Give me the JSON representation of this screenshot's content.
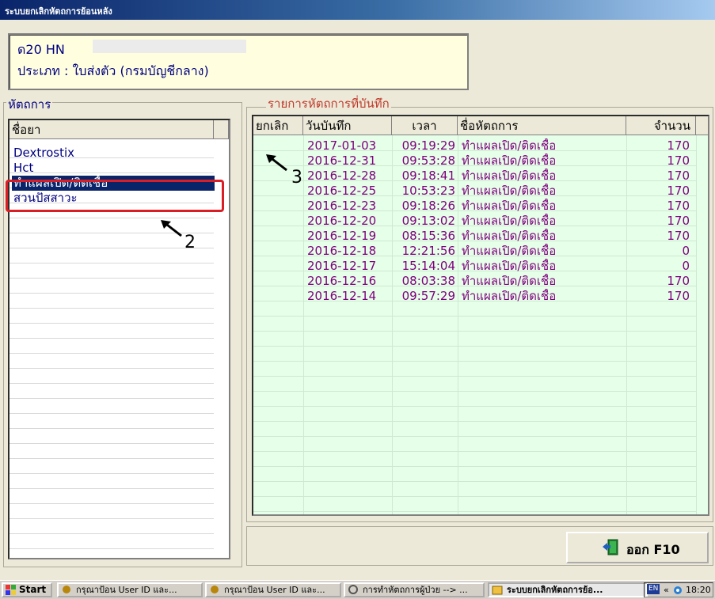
{
  "window": {
    "title": "ระบบยกเลิกหัตถการย้อนหลัง"
  },
  "patient": {
    "line1": "ด20 HN",
    "line2": "ประเภท : ใบส่งตัว (กรมบัญชีกลาง)"
  },
  "left_panel": {
    "group_label": "หัตถการ",
    "column_header": "ชื่อยา",
    "items": [
      "Dextrostix",
      "Hct",
      "ทำแผลเปิด/ติดเชื้อ",
      "สวนปัสสาวะ"
    ],
    "selected_index": 2
  },
  "right_panel": {
    "group_label": "รายการหัตถการที่บันทึก",
    "columns": [
      "ยกเลิก",
      "วันบันทึก",
      "เวลา",
      "ชื่อหัตถการ",
      "จำนวน"
    ],
    "rows": [
      [
        "2017-01-03",
        "09:19:29",
        "ทำแผลเปิด/ติดเชื้อ",
        "170"
      ],
      [
        "2016-12-31",
        "09:53:28",
        "ทำแผลเปิด/ติดเชื้อ",
        "170"
      ],
      [
        "2016-12-28",
        "09:18:41",
        "ทำแผลเปิด/ติดเชื้อ",
        "170"
      ],
      [
        "2016-12-25",
        "10:53:23",
        "ทำแผลเปิด/ติดเชื้อ",
        "170"
      ],
      [
        "2016-12-23",
        "09:18:26",
        "ทำแผลเปิด/ติดเชื้อ",
        "170"
      ],
      [
        "2016-12-20",
        "09:13:02",
        "ทำแผลเปิด/ติดเชื้อ",
        "170"
      ],
      [
        "2016-12-19",
        "08:15:36",
        "ทำแผลเปิด/ติดเชื้อ",
        "170"
      ],
      [
        "2016-12-18",
        "12:21:56",
        "ทำแผลเปิด/ติดเชื้อ",
        "0"
      ],
      [
        "2016-12-17",
        "15:14:04",
        "ทำแผลเปิด/ติดเชื้อ",
        "0"
      ],
      [
        "2016-12-16",
        "08:03:38",
        "ทำแผลเปิด/ติดเชื้อ",
        "170"
      ],
      [
        "2016-12-14",
        "09:57:29",
        "ทำแผลเปิด/ติดเชื้อ",
        "170"
      ]
    ]
  },
  "annotations": {
    "a2": "2",
    "a3": "3"
  },
  "exit_button": {
    "label": "ออก F10"
  },
  "taskbar": {
    "start": "Start",
    "items": [
      "กรุณาป้อน User ID และ...",
      "กรุณาป้อน User ID และ...",
      "การทำหัตถการผู้ป่วย --> ...",
      "ระบบยกเลิกหัตถการย้อ..."
    ],
    "lang": "EN",
    "chevron": "«",
    "clock": "18:20"
  },
  "colors": {
    "title_bar": "#0a246a",
    "selected_row": "#0a246a",
    "text_blue": "#000080",
    "text_purple": "#800080",
    "grid_green": "#e6ffe8",
    "annotation_red": "#d91e25",
    "info_bg": "#ffffe0"
  }
}
